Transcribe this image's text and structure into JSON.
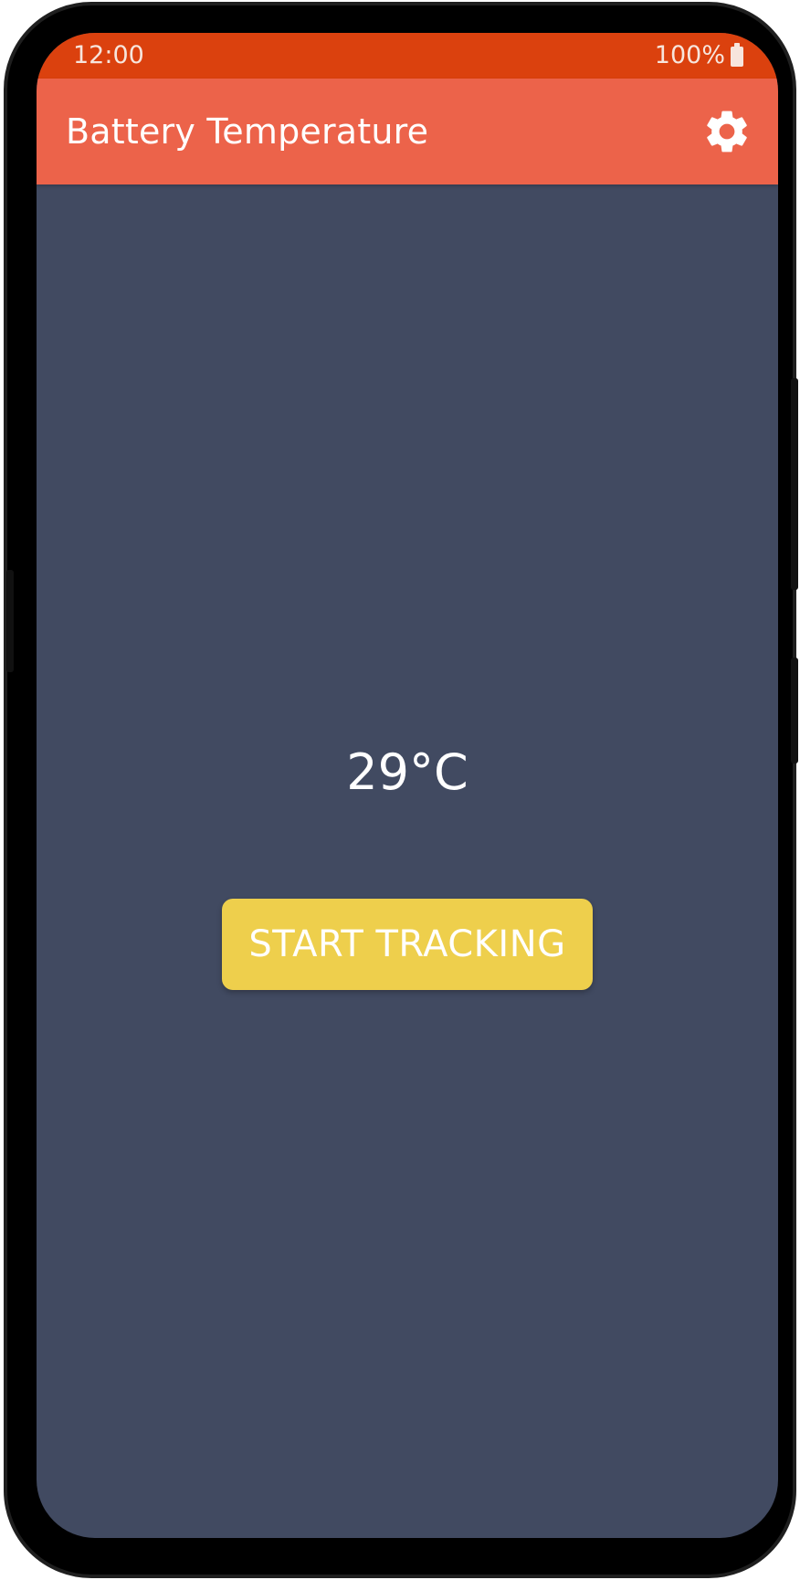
{
  "status_bar": {
    "time": "12:00",
    "battery_level": "100%",
    "battery_icon": "battery-full-icon"
  },
  "app_bar": {
    "title": "Battery Temperature",
    "settings_icon": "gear-icon"
  },
  "main": {
    "temperature": "29°C",
    "start_button_label": "START TRACKING"
  },
  "colors": {
    "status_bar": "#db410e",
    "app_bar": "#ec634a",
    "background": "#414a61",
    "button": "#eecf4c",
    "text": "#ffffff"
  }
}
